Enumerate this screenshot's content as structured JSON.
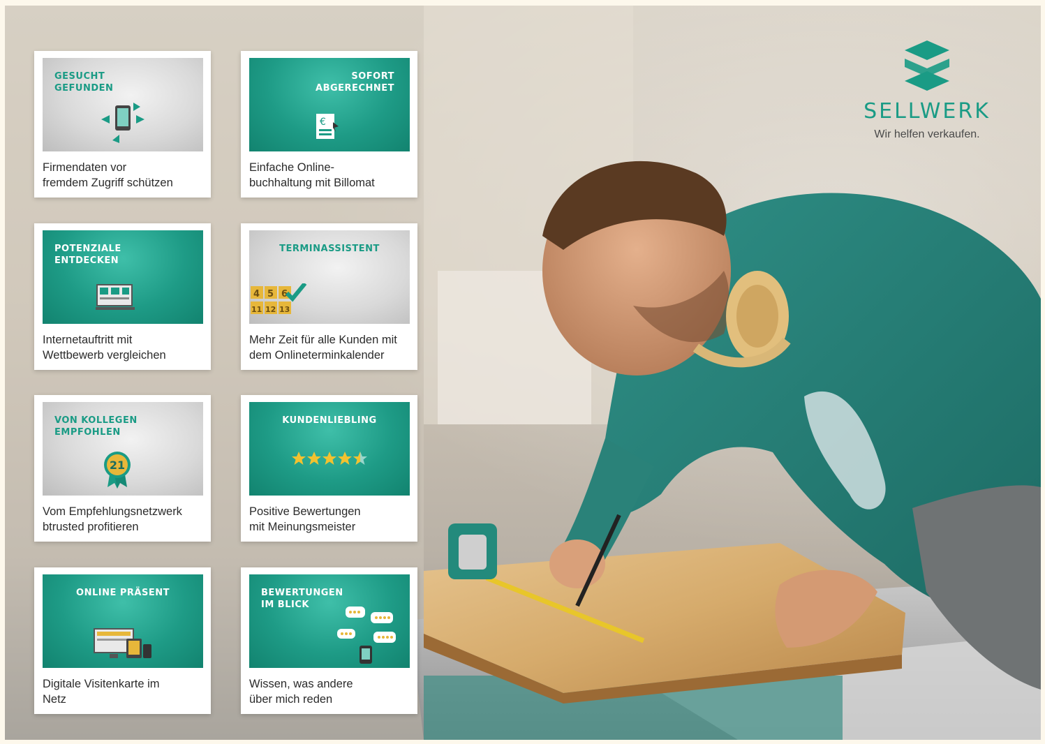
{
  "brand": {
    "name": "SELLWERK",
    "tagline": "Wir helfen verkaufen.",
    "teal": "#1a9b85",
    "logo_icon": "sellwerk-s-logo-icon"
  },
  "cards": [
    {
      "title": "GESUCHT\nGEFUNDEN",
      "caption": "Firmendaten vor\nfremdem Zugriff schützen",
      "style": "gray",
      "icon": "smartphone-arrows-icon"
    },
    {
      "title": "SOFORT\nABGERECHNET",
      "caption": "Einfache Online-\nbuchhaltung mit Billomat",
      "style": "teal",
      "icon": "euro-invoice-icon"
    },
    {
      "title": "POTENZIALE\nENTDECKEN",
      "caption": "Internetauftritt mit\nWettbewerb vergleichen",
      "style": "teal",
      "icon": "website-compare-icon"
    },
    {
      "title": "TERMINASSISTENT",
      "caption": "Mehr Zeit für alle Kunden mit\ndem Onlineterminkalender",
      "style": "gray",
      "icon": "calendar-check-icon",
      "calendar": {
        "row1": [
          "4",
          "5",
          "6"
        ],
        "row2": [
          "11",
          "12",
          "13"
        ]
      }
    },
    {
      "title": "VON KOLLEGEN\nEMPFOHLEN",
      "caption": "Vom Empfehlungsnetzwerk\nbtrusted profitieren",
      "style": "gray",
      "icon": "award-badge-icon",
      "badge_number": "21"
    },
    {
      "title": "KUNDENLIEBLING",
      "caption": "Positive Bewertungen\nmit Meinungsmeister",
      "style": "teal",
      "icon": "star-rating-icon",
      "rating": 4.5,
      "rating_max": 5
    },
    {
      "title": "ONLINE PRÄSENT",
      "caption": "Digitale Visitenkarte im\nNetz",
      "style": "teal",
      "icon": "devices-icon"
    },
    {
      "title": "BEWERTUNGEN\nIM BLICK",
      "caption": "Wissen, was andere\nüber mich reden",
      "style": "teal",
      "icon": "review-bubbles-icon"
    }
  ]
}
